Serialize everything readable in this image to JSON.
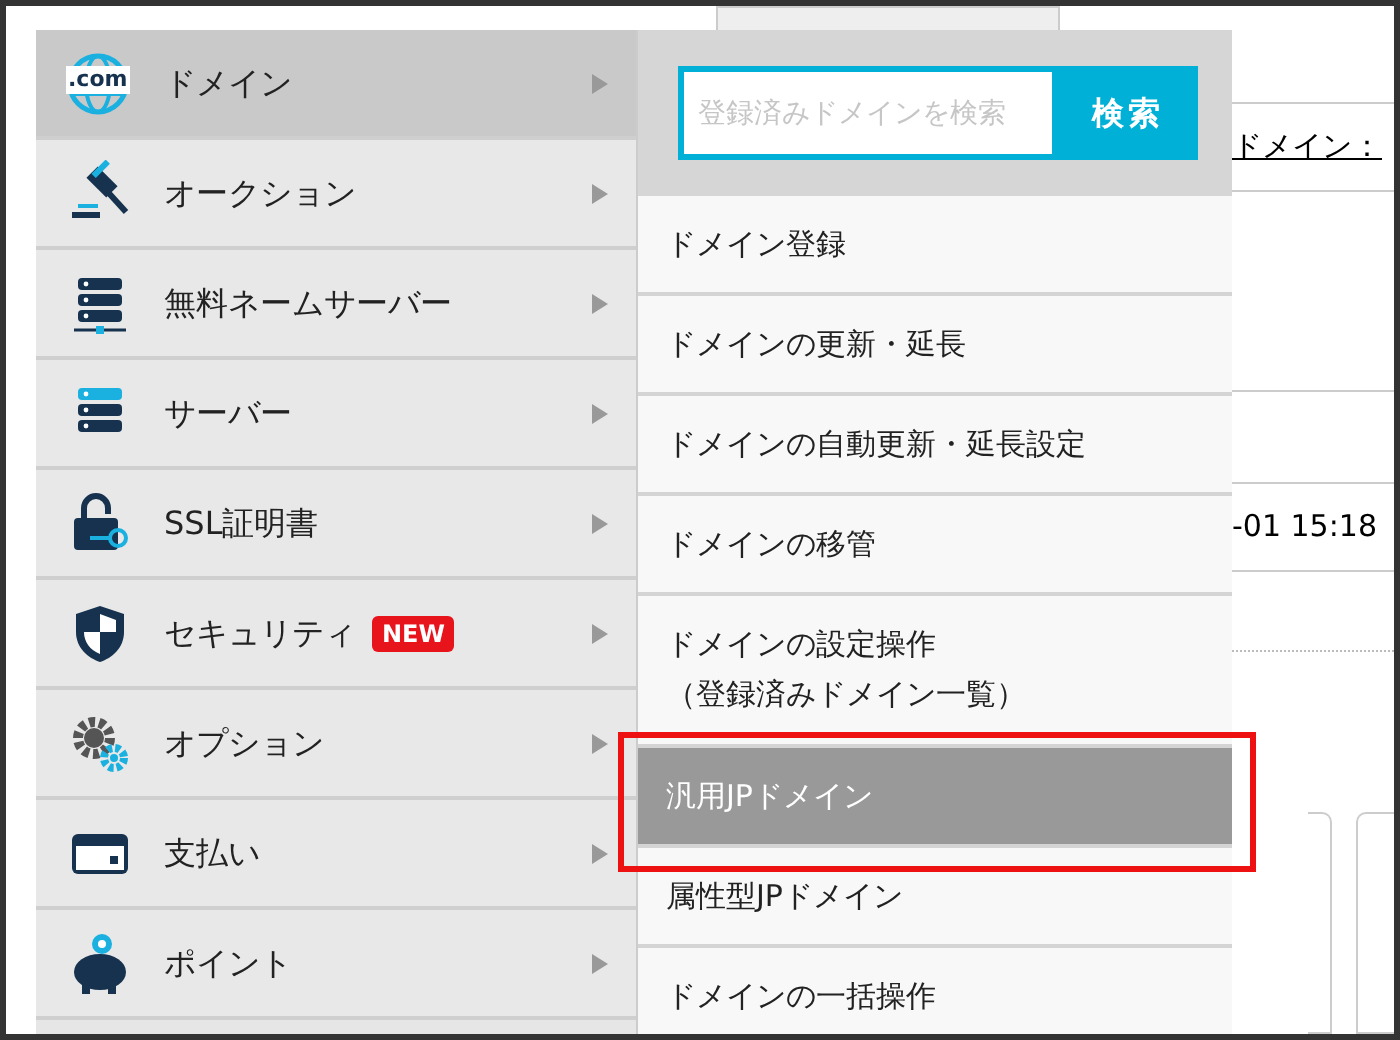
{
  "menu": [
    {
      "label": "ドメイン",
      "icon_label": ".com",
      "selected": true
    },
    {
      "label": "オークション",
      "selected": false
    },
    {
      "label": "無料ネームサーバー",
      "selected": false
    },
    {
      "label": "サーバー",
      "selected": false
    },
    {
      "label": "SSL証明書",
      "selected": false
    },
    {
      "label": "セキュリティ",
      "badge": "NEW",
      "selected": false
    },
    {
      "label": "オプション",
      "selected": false
    },
    {
      "label": "支払い",
      "selected": false
    },
    {
      "label": "ポイント",
      "selected": false
    }
  ],
  "submenu": {
    "search": {
      "placeholder": "登録済みドメインを検索",
      "button": "検索"
    },
    "items": [
      {
        "label": "ドメイン登録",
        "selected": false,
        "highlighted": false
      },
      {
        "label": "ドメインの更新・延長",
        "selected": false,
        "highlighted": false
      },
      {
        "label": "ドメインの自動更新・延長設定",
        "selected": false,
        "highlighted": false
      },
      {
        "label": "ドメインの移管",
        "selected": false,
        "highlighted": false
      },
      {
        "label": "ドメインの設定操作",
        "sublabel": "（登録済みドメイン一覧）",
        "selected": false,
        "highlighted": false
      },
      {
        "label": "汎用JPドメイン",
        "selected": true,
        "highlighted": true
      },
      {
        "label": "属性型JPドメイン",
        "selected": false,
        "highlighted": false
      },
      {
        "label": "ドメインの一括操作",
        "selected": false,
        "highlighted": false
      }
    ]
  },
  "background": {
    "link": "ドメイン：",
    "time": "-01 15:18"
  }
}
